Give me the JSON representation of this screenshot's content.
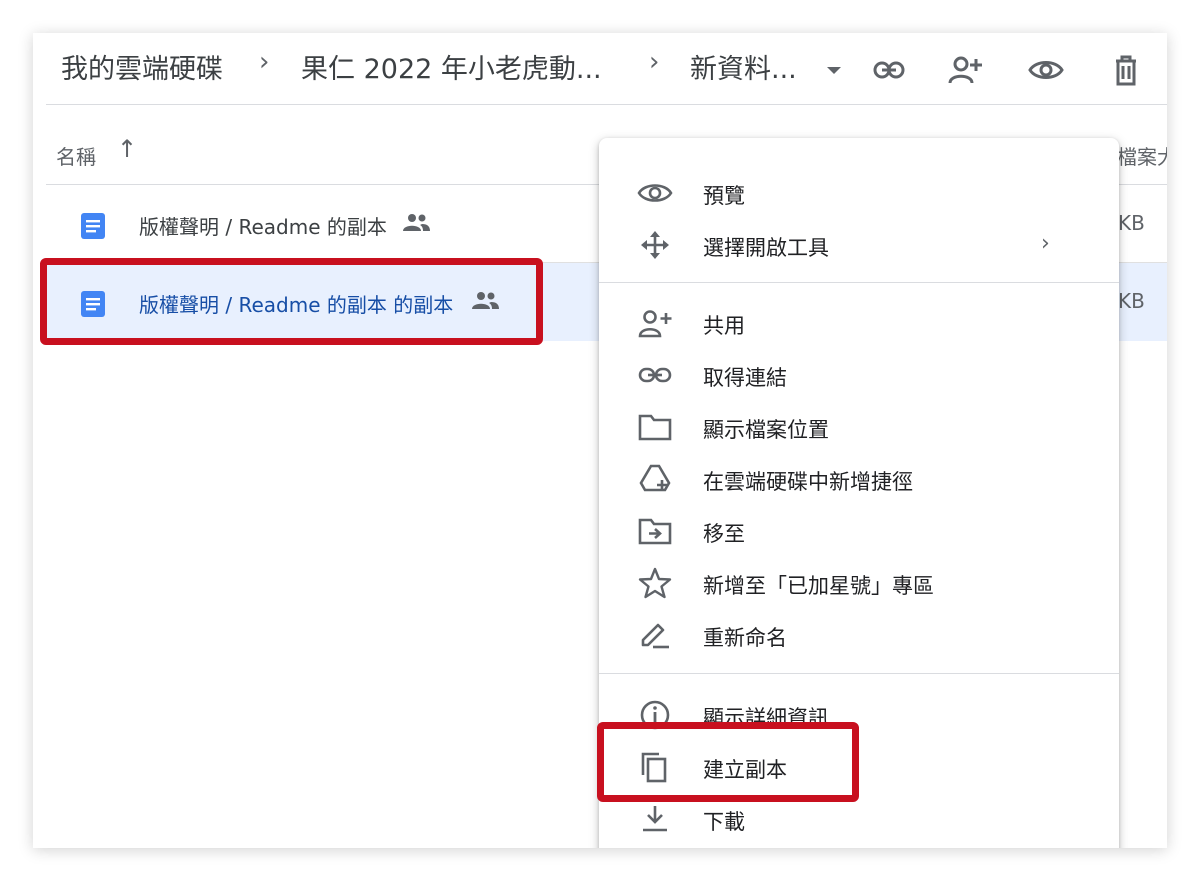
{
  "breadcrumb": {
    "root": "我的雲端硬碟",
    "folder": "果仁 2022 年小老虎動...",
    "current": "新資料..."
  },
  "columns": {
    "name": "名稱",
    "size": "檔案大小"
  },
  "files": [
    {
      "name": "版權聲明 / Readme 的副本",
      "size": "KB",
      "shared": true
    },
    {
      "name": "版權聲明 / Readme 的副本 的副本",
      "size": "KB",
      "shared": true,
      "selected": true
    }
  ],
  "context_menu": {
    "items": [
      {
        "label": "預覽",
        "icon": "eye-icon"
      },
      {
        "label": "選擇開啟工具",
        "icon": "move-arrows-icon",
        "submenu": true
      },
      {
        "label": "共用",
        "icon": "person-add-icon"
      },
      {
        "label": "取得連結",
        "icon": "link-icon"
      },
      {
        "label": "顯示檔案位置",
        "icon": "folder-icon"
      },
      {
        "label": "在雲端硬碟中新增捷徑",
        "icon": "drive-shortcut-icon"
      },
      {
        "label": "移至",
        "icon": "move-to-folder-icon"
      },
      {
        "label": "新增至「已加星號」專區",
        "icon": "star-icon"
      },
      {
        "label": "重新命名",
        "icon": "pencil-icon"
      },
      {
        "label": "顯示詳細資訊",
        "icon": "info-icon"
      },
      {
        "label": "建立副本",
        "icon": "copy-icon"
      },
      {
        "label": "下載",
        "icon": "download-icon"
      }
    ]
  },
  "colors": {
    "highlight": "#c8101f",
    "selected_row": "#e8f0fe",
    "doc_blue": "#4285f4"
  }
}
